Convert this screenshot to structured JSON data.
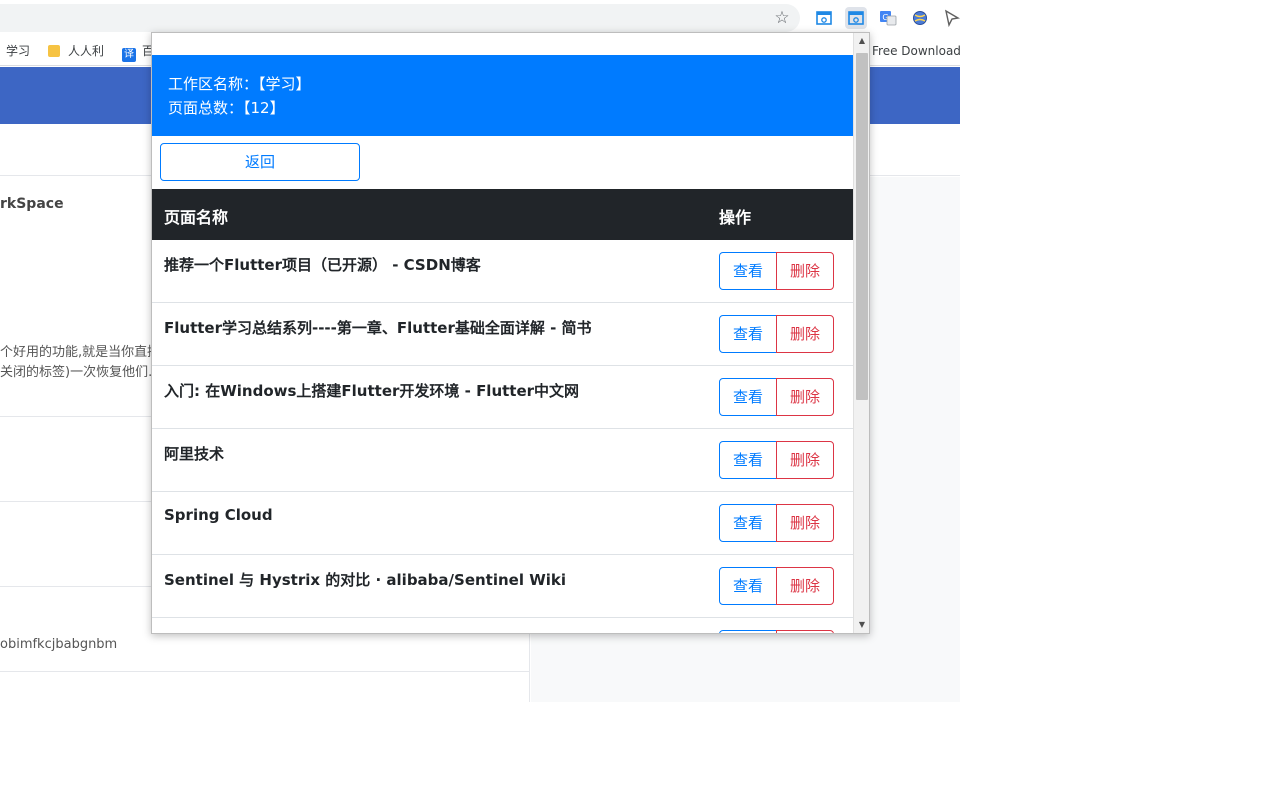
{
  "browser": {
    "bookmarks": [
      {
        "label": "学习"
      },
      {
        "label": "人人利"
      },
      {
        "label": "百"
      },
      {
        "label": "Free Download"
      }
    ]
  },
  "background_page": {
    "title_fragment": "rkSpace",
    "text_line_1": "个好用的功能,就是当你直接",
    "text_line_2": "关闭的标签)一次恢复他们.但",
    "id_fragment": "obimfkcjbabgnbm"
  },
  "popup": {
    "workspace_label": "工作区名称：【学习】",
    "page_count_label": "页面总数：【12】",
    "back_button": "返回",
    "table": {
      "col_name": "页面名称",
      "col_action": "操作",
      "view_label": "查看",
      "delete_label": "删除",
      "rows": [
        {
          "title": "推荐一个Flutter项目（已开源） - CSDN博客"
        },
        {
          "title": "Flutter学习总结系列----第一章、Flutter基础全面详解 - 简书"
        },
        {
          "title": "入门: 在Windows上搭建Flutter开发环境 - Flutter中文网"
        },
        {
          "title": "阿里技术"
        },
        {
          "title": "Spring Cloud"
        },
        {
          "title": "Sentinel 与 Hystrix 的对比 · alibaba/Sentinel Wiki"
        }
      ]
    }
  },
  "colors": {
    "primary": "#007bff",
    "danger": "#dc3545",
    "table_header": "#212529",
    "page_header": "#3d66c4"
  }
}
